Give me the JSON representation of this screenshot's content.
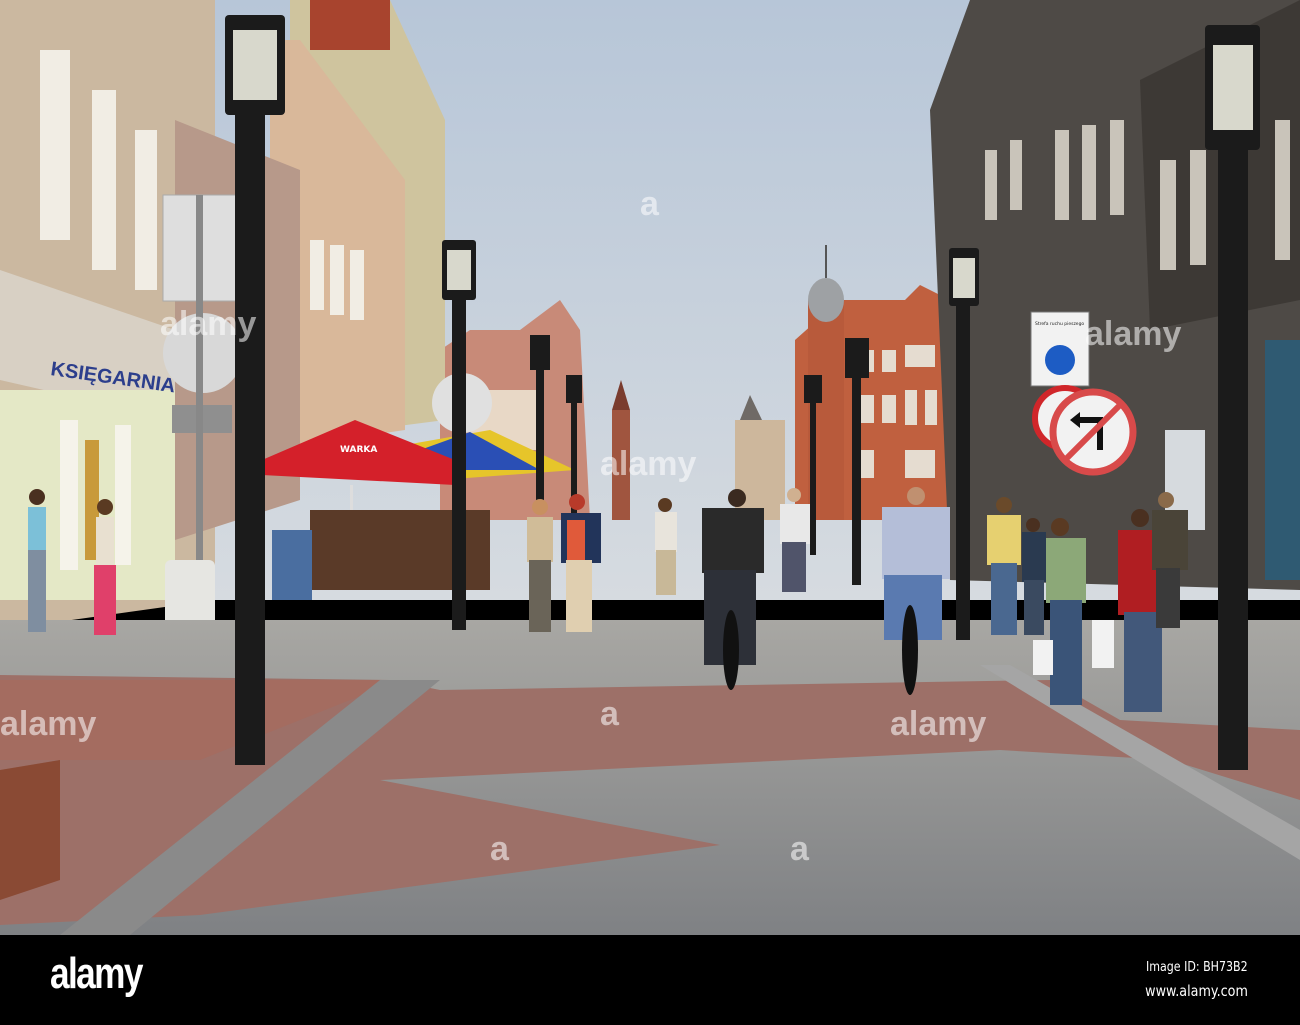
{
  "photo": {
    "shop_sign": "KSIĘGARNIA",
    "umbrella_brand": "WARKA",
    "pedestrian_zone_sign": "Strefa ruchu pieszego",
    "watermark": "alamy"
  },
  "footer": {
    "logo": "alamy",
    "image_id": "Image ID: BH73B2",
    "website": "www.alamy.com"
  },
  "colors": {
    "sky": "#c3cfdc",
    "paving": "#8d8f91",
    "brick": "#9a6a62",
    "umbrella_red": "#d4202a",
    "footer": "#000000"
  }
}
